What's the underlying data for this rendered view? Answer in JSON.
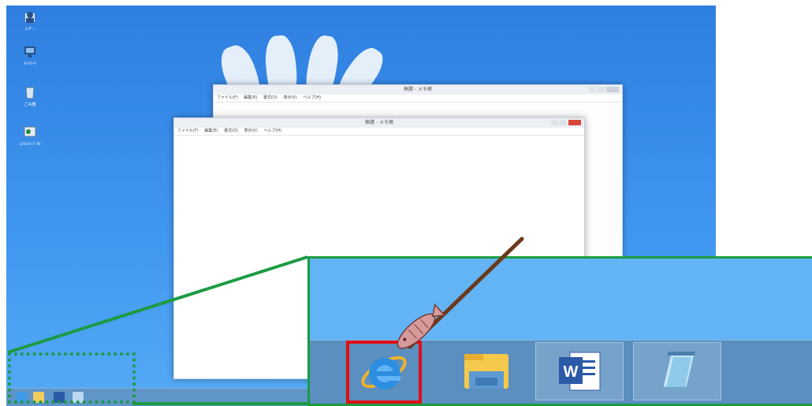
{
  "desktop": {
    "icons": [
      {
        "name": "user-folder-icon",
        "label": "ﾕｰｻﾞｰ"
      },
      {
        "name": "network-icon",
        "label": "ﾈｯﾄﾜｰｸ"
      },
      {
        "name": "recycle-bin-icon",
        "label": "ごみ箱"
      },
      {
        "name": "control-panel-icon",
        "label": "ｺﾝﾄﾛｰﾙ ﾊﾟﾈﾙ"
      }
    ],
    "back_window": {
      "title": "無題 - メモ帳",
      "menu": [
        "ファイル(F)",
        "編集(E)",
        "書式(O)",
        "表示(V)",
        "ヘルプ(H)"
      ]
    },
    "front_window": {
      "title": "無題 - メモ帳",
      "menu": [
        "ファイル(F)",
        "編集(E)",
        "書式(O)",
        "表示(V)",
        "ヘルプ(H)"
      ]
    },
    "taskbar_icons": [
      "internet-explorer-icon",
      "file-explorer-icon",
      "word-icon",
      "notepad-icon"
    ]
  },
  "zoom": {
    "taskbar_buttons": [
      {
        "name": "internet-explorer-button",
        "icon": "internet-explorer-icon",
        "active": false,
        "highlighted": true
      },
      {
        "name": "file-explorer-button",
        "icon": "file-explorer-icon",
        "active": false,
        "highlighted": false
      },
      {
        "name": "word-button",
        "icon": "word-icon",
        "active": true,
        "highlighted": false
      },
      {
        "name": "notepad-button",
        "icon": "notepad-icon",
        "active": true,
        "highlighted": false
      }
    ],
    "colors": {
      "callout_border": "#1c9b43",
      "highlight_box": "#e00e12",
      "taskbar": "#5a8fc0"
    }
  }
}
